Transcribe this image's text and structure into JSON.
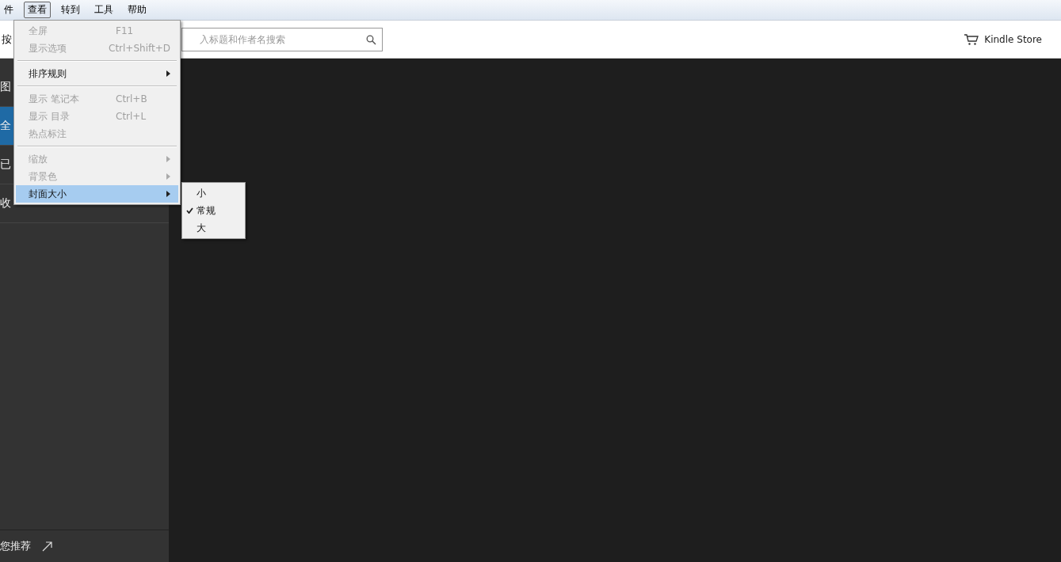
{
  "menubar": [
    {
      "label": "件",
      "selected": false
    },
    {
      "label": "查看",
      "selected": true
    },
    {
      "label": "转到",
      "selected": false
    },
    {
      "label": "工具",
      "selected": false
    },
    {
      "label": "帮助",
      "selected": false
    }
  ],
  "toolbar": {
    "button": "按",
    "search": {
      "placeholder": "入标题和作者名搜索"
    },
    "store_link": "Kindle Store"
  },
  "sidebar": {
    "items": [
      {
        "label": "图",
        "selected": false
      },
      {
        "label": "全",
        "selected": true
      },
      {
        "label": "已",
        "selected": false
      },
      {
        "label": "收",
        "selected": false
      }
    ],
    "footer_link": "您推荐"
  },
  "view_menu": [
    {
      "kind": "item",
      "label": "全屏",
      "shortcut": "F11",
      "disabled": true,
      "submenu": false,
      "selected": false
    },
    {
      "kind": "item",
      "label": "显示选项",
      "shortcut": "Ctrl+Shift+D",
      "disabled": true,
      "submenu": false,
      "selected": false
    },
    {
      "kind": "separator"
    },
    {
      "kind": "item",
      "label": "排序规则",
      "disabled": false,
      "submenu": true,
      "selected": false
    },
    {
      "kind": "separator"
    },
    {
      "kind": "item",
      "label": "显示 笔记本",
      "shortcut": "Ctrl+B",
      "disabled": true,
      "submenu": false,
      "selected": false
    },
    {
      "kind": "item",
      "label": "显示 目录",
      "shortcut": "Ctrl+L",
      "disabled": true,
      "submenu": false,
      "selected": false
    },
    {
      "kind": "item",
      "label": "热点标注",
      "disabled": true,
      "submenu": false,
      "selected": false
    },
    {
      "kind": "separator"
    },
    {
      "kind": "item",
      "label": "缩放",
      "disabled": true,
      "submenu": true,
      "selected": false
    },
    {
      "kind": "item",
      "label": "背景色",
      "disabled": true,
      "submenu": true,
      "selected": false
    },
    {
      "kind": "item",
      "label": "封面大小",
      "disabled": false,
      "submenu": true,
      "selected": true
    }
  ],
  "cover_size_menu": [
    {
      "label": "小",
      "checked": false
    },
    {
      "label": "常规",
      "checked": true
    },
    {
      "label": "大",
      "checked": false
    }
  ]
}
